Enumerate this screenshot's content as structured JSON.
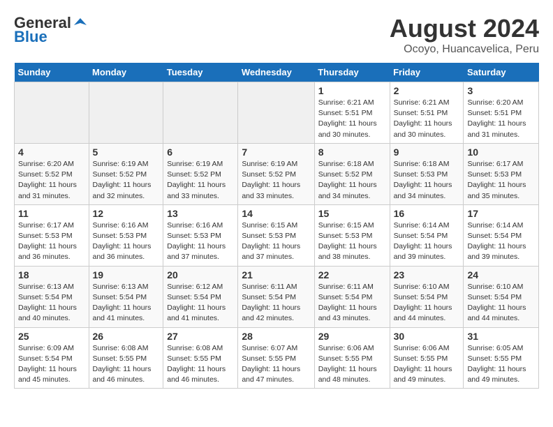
{
  "header": {
    "logo_general": "General",
    "logo_blue": "Blue",
    "month_year": "August 2024",
    "location": "Ocoyo, Huancavelica, Peru"
  },
  "days_of_week": [
    "Sunday",
    "Monday",
    "Tuesday",
    "Wednesday",
    "Thursday",
    "Friday",
    "Saturday"
  ],
  "weeks": [
    [
      {
        "day": "",
        "empty": true
      },
      {
        "day": "",
        "empty": true
      },
      {
        "day": "",
        "empty": true
      },
      {
        "day": "",
        "empty": true
      },
      {
        "day": "1",
        "sunrise": "6:21 AM",
        "sunset": "5:51 PM",
        "daylight": "11 hours and 30 minutes."
      },
      {
        "day": "2",
        "sunrise": "6:21 AM",
        "sunset": "5:51 PM",
        "daylight": "11 hours and 30 minutes."
      },
      {
        "day": "3",
        "sunrise": "6:20 AM",
        "sunset": "5:51 PM",
        "daylight": "11 hours and 31 minutes."
      }
    ],
    [
      {
        "day": "4",
        "sunrise": "6:20 AM",
        "sunset": "5:52 PM",
        "daylight": "11 hours and 31 minutes."
      },
      {
        "day": "5",
        "sunrise": "6:19 AM",
        "sunset": "5:52 PM",
        "daylight": "11 hours and 32 minutes."
      },
      {
        "day": "6",
        "sunrise": "6:19 AM",
        "sunset": "5:52 PM",
        "daylight": "11 hours and 33 minutes."
      },
      {
        "day": "7",
        "sunrise": "6:19 AM",
        "sunset": "5:52 PM",
        "daylight": "11 hours and 33 minutes."
      },
      {
        "day": "8",
        "sunrise": "6:18 AM",
        "sunset": "5:52 PM",
        "daylight": "11 hours and 34 minutes."
      },
      {
        "day": "9",
        "sunrise": "6:18 AM",
        "sunset": "5:53 PM",
        "daylight": "11 hours and 34 minutes."
      },
      {
        "day": "10",
        "sunrise": "6:17 AM",
        "sunset": "5:53 PM",
        "daylight": "11 hours and 35 minutes."
      }
    ],
    [
      {
        "day": "11",
        "sunrise": "6:17 AM",
        "sunset": "5:53 PM",
        "daylight": "11 hours and 36 minutes."
      },
      {
        "day": "12",
        "sunrise": "6:16 AM",
        "sunset": "5:53 PM",
        "daylight": "11 hours and 36 minutes."
      },
      {
        "day": "13",
        "sunrise": "6:16 AM",
        "sunset": "5:53 PM",
        "daylight": "11 hours and 37 minutes."
      },
      {
        "day": "14",
        "sunrise": "6:15 AM",
        "sunset": "5:53 PM",
        "daylight": "11 hours and 37 minutes."
      },
      {
        "day": "15",
        "sunrise": "6:15 AM",
        "sunset": "5:53 PM",
        "daylight": "11 hours and 38 minutes."
      },
      {
        "day": "16",
        "sunrise": "6:14 AM",
        "sunset": "5:54 PM",
        "daylight": "11 hours and 39 minutes."
      },
      {
        "day": "17",
        "sunrise": "6:14 AM",
        "sunset": "5:54 PM",
        "daylight": "11 hours and 39 minutes."
      }
    ],
    [
      {
        "day": "18",
        "sunrise": "6:13 AM",
        "sunset": "5:54 PM",
        "daylight": "11 hours and 40 minutes."
      },
      {
        "day": "19",
        "sunrise": "6:13 AM",
        "sunset": "5:54 PM",
        "daylight": "11 hours and 41 minutes."
      },
      {
        "day": "20",
        "sunrise": "6:12 AM",
        "sunset": "5:54 PM",
        "daylight": "11 hours and 41 minutes."
      },
      {
        "day": "21",
        "sunrise": "6:11 AM",
        "sunset": "5:54 PM",
        "daylight": "11 hours and 42 minutes."
      },
      {
        "day": "22",
        "sunrise": "6:11 AM",
        "sunset": "5:54 PM",
        "daylight": "11 hours and 43 minutes."
      },
      {
        "day": "23",
        "sunrise": "6:10 AM",
        "sunset": "5:54 PM",
        "daylight": "11 hours and 44 minutes."
      },
      {
        "day": "24",
        "sunrise": "6:10 AM",
        "sunset": "5:54 PM",
        "daylight": "11 hours and 44 minutes."
      }
    ],
    [
      {
        "day": "25",
        "sunrise": "6:09 AM",
        "sunset": "5:54 PM",
        "daylight": "11 hours and 45 minutes."
      },
      {
        "day": "26",
        "sunrise": "6:08 AM",
        "sunset": "5:55 PM",
        "daylight": "11 hours and 46 minutes."
      },
      {
        "day": "27",
        "sunrise": "6:08 AM",
        "sunset": "5:55 PM",
        "daylight": "11 hours and 46 minutes."
      },
      {
        "day": "28",
        "sunrise": "6:07 AM",
        "sunset": "5:55 PM",
        "daylight": "11 hours and 47 minutes."
      },
      {
        "day": "29",
        "sunrise": "6:06 AM",
        "sunset": "5:55 PM",
        "daylight": "11 hours and 48 minutes."
      },
      {
        "day": "30",
        "sunrise": "6:06 AM",
        "sunset": "5:55 PM",
        "daylight": "11 hours and 49 minutes."
      },
      {
        "day": "31",
        "sunrise": "6:05 AM",
        "sunset": "5:55 PM",
        "daylight": "11 hours and 49 minutes."
      }
    ]
  ],
  "labels": {
    "sunrise": "Sunrise:",
    "sunset": "Sunset:",
    "daylight": "Daylight:"
  }
}
